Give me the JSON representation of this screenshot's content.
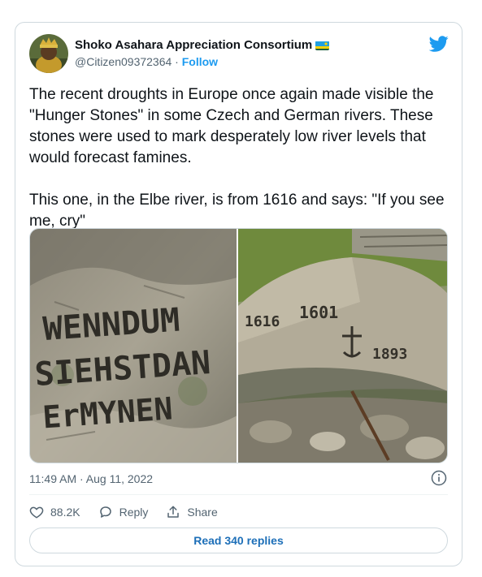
{
  "author": {
    "name": "Shoko Asahara Appreciation Consortium",
    "handle": "@Citizen09372364",
    "separator": " · ",
    "follow_label": "Follow"
  },
  "tweet": {
    "text": "The recent droughts in Europe once again made visible the \"Hunger Stones\" in some Czech and German rivers. These stones were used to mark desperately low river levels that would forecast famines.\n\nThis one, in the Elbe river, is from 1616 and says: \"If you see me, cry\"",
    "timestamp": "11:49 AM · Aug 11, 2022"
  },
  "photos": {
    "left_inscription": [
      "WENNDUM",
      "SIEHSTDAN",
      "ErMYNEN"
    ],
    "right_inscription": [
      "1616",
      "1601",
      "1893"
    ]
  },
  "actions": {
    "likes": "88.2K",
    "reply_label": "Reply",
    "share_label": "Share"
  },
  "read_replies_label": "Read 340 replies",
  "icons": {
    "brand": "twitter-bird-icon",
    "info": "info-icon",
    "like": "heart-icon",
    "reply": "reply-icon",
    "share": "share-icon"
  },
  "colors": {
    "accent": "#1d9bf0",
    "muted_text": "#536471",
    "border": "#cfd9de"
  }
}
